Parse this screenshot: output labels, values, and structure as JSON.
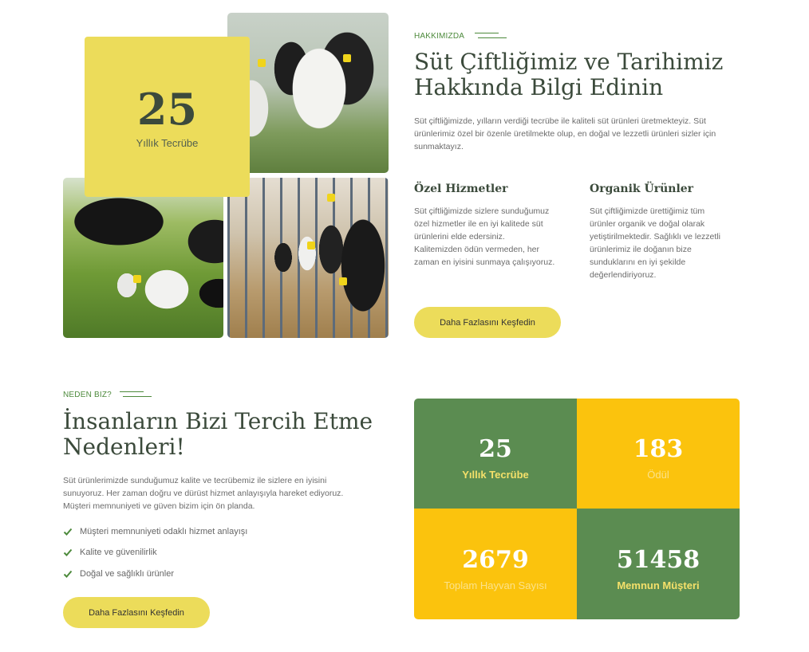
{
  "about": {
    "eyebrow": "HAKKIMIZDA",
    "title_line1": "Süt Çiftliğimiz ve Tarihimiz",
    "title_line2": "Hakkında Bilgi Edinin",
    "intro_line1": "Süt çiftliğimizde, yılların verdiği tecrübe ile kaliteli süt ürünleri üretmekteyiz. Süt",
    "intro_line2": "ürünlerimiz özel bir özenle üretilmekte olup, en doğal ve lezzetli ürünleri sizler için",
    "intro_line3": "sunmaktayız.",
    "features": [
      {
        "title": "Özel Hizmetler",
        "lines": [
          "Süt çiftliğimizde sizlere sunduğumuz",
          "özel hizmetler ile en iyi kalitede süt",
          "ürünlerini elde edersiniz.",
          "Kalitemizden ödün vermeden, her",
          "zaman en iyisini sunmaya çalışıyoruz."
        ]
      },
      {
        "title": "Organik Ürünler",
        "lines": [
          "Süt çiftliğimizde ürettiğimiz tüm",
          "ürünler organik ve doğal olarak",
          "yetiştirilmektedir. Sağlıklı ve lezzetli",
          "ürünlerimiz ile doğanın bize",
          "sunduklarını en iyi şekilde",
          "değerlendiriyoruz."
        ]
      }
    ],
    "button_label": "Daha Fazlasını Keşfedin",
    "experience": {
      "number": "25",
      "label": "Yıllık Tecrübe"
    }
  },
  "why": {
    "eyebrow": "NEDEN BIZ?",
    "title_line1": "İnsanların Bizi Tercih Etme",
    "title_line2": "Nedenleri!",
    "intro_line1": "Süt ürünlerimizde sunduğumuz kalite ve tecrübemiz ile sizlere en iyisini",
    "intro_line2": "sunuyoruz. Her zaman doğru ve dürüst hizmet anlayışıyla hareket ediyoruz.",
    "intro_line3": "Müşteri memnuniyeti ve güven bizim için ön planda.",
    "checklist": [
      "Müşteri memnuniyeti odaklı hizmet anlayışı",
      "Kalite ve güvenilirlik",
      "Doğal ve sağlıklı ürünler"
    ],
    "button_label": "Daha Fazlasını Keşfedin"
  },
  "stats": [
    {
      "number": "25",
      "label": "Yıllık Tecrübe",
      "color": "#5b8c51"
    },
    {
      "number": "183",
      "label": "Ödül",
      "color": "#fbc30d"
    },
    {
      "number": "2679",
      "label": "Toplam Hayvan Sayısı",
      "color": "#fbc30d"
    },
    {
      "number": "51458",
      "label": "Memnun Müşteri",
      "color": "#5b8c51"
    }
  ],
  "colors": {
    "accent_yellow": "#ecdc5a",
    "stat_green": "#5b8c51",
    "stat_yellow": "#fbc30d",
    "heading": "#3b4a3b",
    "eyebrow_green": "#4d8a3c"
  },
  "icons": {
    "check": "check-icon"
  }
}
